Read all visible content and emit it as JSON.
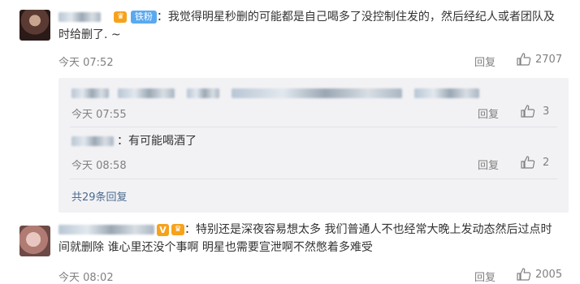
{
  "comments": [
    {
      "text_line1": "：我觉得明星秒删的可能都是自己喝多了没控制住发的，然后经纪人或者团队及",
      "text_line2": "时给删了. ~",
      "badge": "铁粉",
      "time": "今天 07:52",
      "reply_label": "回复",
      "likes": "2707"
    },
    {
      "text_line1": "：特别还是深夜容易想太多 我们普通人不也经常大晚上发动态然后过点时",
      "text_line2": "间就删除 谁心里还没个事啊 明星也需要宣泄啊不然憋着多难受",
      "badge": "V",
      "time": "今天 08:02",
      "reply_label": "回复",
      "likes": "2005"
    }
  ],
  "replies": [
    {
      "text": "",
      "time": "今天 07:55",
      "reply_label": "回复",
      "likes": "3"
    },
    {
      "text": "有可能喝酒了",
      "time": "今天 08:58",
      "reply_label": "回复",
      "likes": "2"
    }
  ],
  "replies_more": "共29条回复",
  "icons": {
    "like": "thumbs-up-icon",
    "vip": "vip-badge-icon"
  },
  "colors": {
    "link": "#4b6b8f",
    "badge_fan": "#5aa9ef",
    "badge_vip": "#f7a21b",
    "reply_bg": "#f2f2f5"
  }
}
